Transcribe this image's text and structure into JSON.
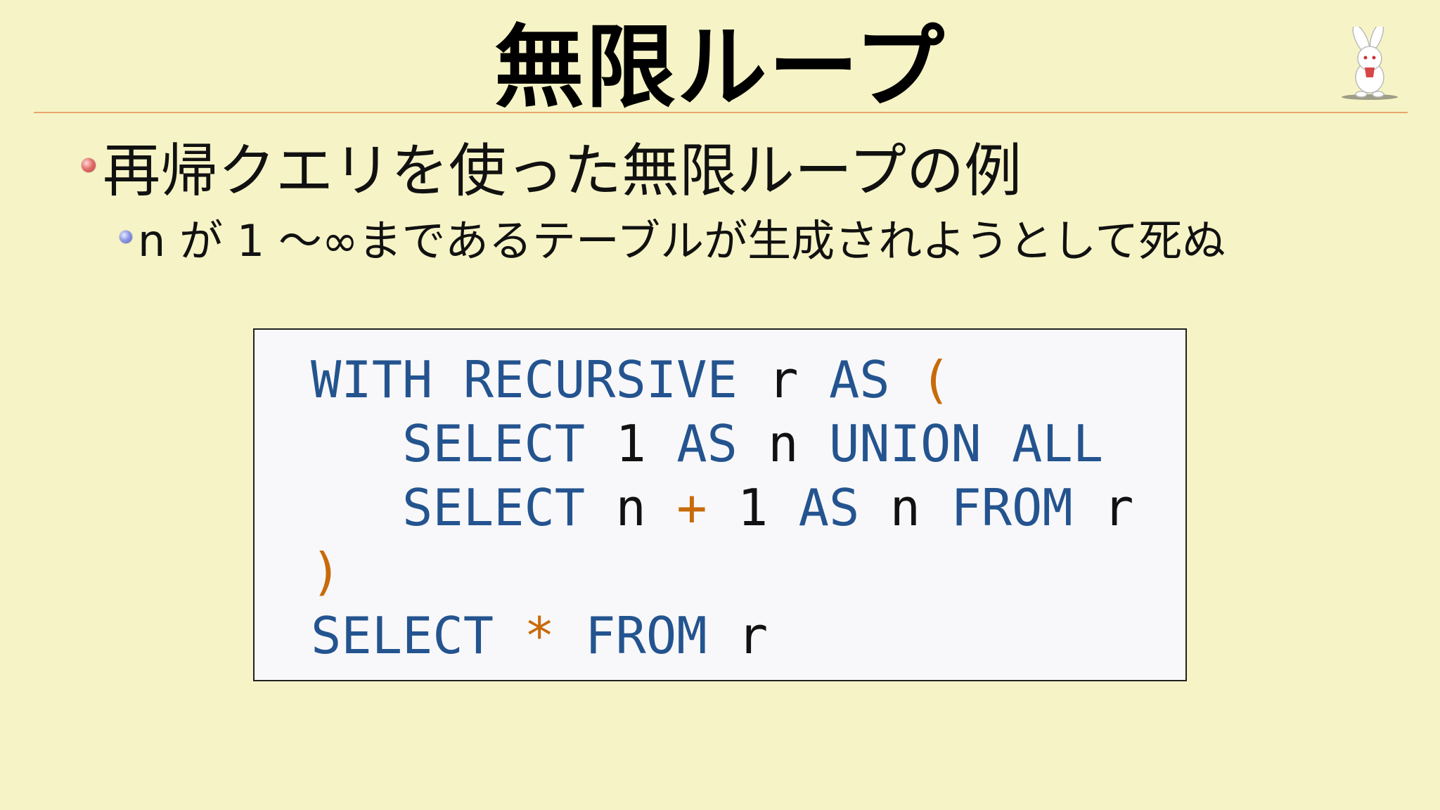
{
  "slide": {
    "title": "無限ループ",
    "mascot_icon": "rabbit-mascot-icon"
  },
  "bullets": [
    {
      "level": 1,
      "text": "再帰クエリを使った無限ループの例",
      "sub": [
        {
          "level": 2,
          "text": "n が 1 〜∞まであるテーブルが生成されようとして死ぬ"
        }
      ]
    }
  ],
  "code": {
    "language": "SQL",
    "lines": [
      [
        {
          "t": "WITH",
          "c": "kw"
        },
        {
          "t": " "
        },
        {
          "t": "RECURSIVE",
          "c": "kw"
        },
        {
          "t": " r "
        },
        {
          "t": "AS",
          "c": "kw"
        },
        {
          "t": " "
        },
        {
          "t": "(",
          "c": "op"
        }
      ],
      [
        {
          "t": "   "
        },
        {
          "t": "SELECT",
          "c": "kw"
        },
        {
          "t": " 1 "
        },
        {
          "t": "AS",
          "c": "kw"
        },
        {
          "t": " n "
        },
        {
          "t": "UNION",
          "c": "kw"
        },
        {
          "t": " "
        },
        {
          "t": "ALL",
          "c": "kw"
        }
      ],
      [
        {
          "t": "   "
        },
        {
          "t": "SELECT",
          "c": "kw"
        },
        {
          "t": " n "
        },
        {
          "t": "+",
          "c": "op"
        },
        {
          "t": " 1 "
        },
        {
          "t": "AS",
          "c": "kw"
        },
        {
          "t": " n "
        },
        {
          "t": "FROM",
          "c": "kw"
        },
        {
          "t": " r"
        }
      ],
      [
        {
          "t": ")",
          "c": "op"
        }
      ],
      [
        {
          "t": "SELECT",
          "c": "kw"
        },
        {
          "t": " "
        },
        {
          "t": "*",
          "c": "op"
        },
        {
          "t": " "
        },
        {
          "t": "FROM",
          "c": "kw"
        },
        {
          "t": " r"
        }
      ]
    ]
  },
  "colors": {
    "background": "#f6f4c6",
    "rule": "#e8a56c",
    "keyword": "#24548f",
    "operator": "#c86a0a"
  }
}
